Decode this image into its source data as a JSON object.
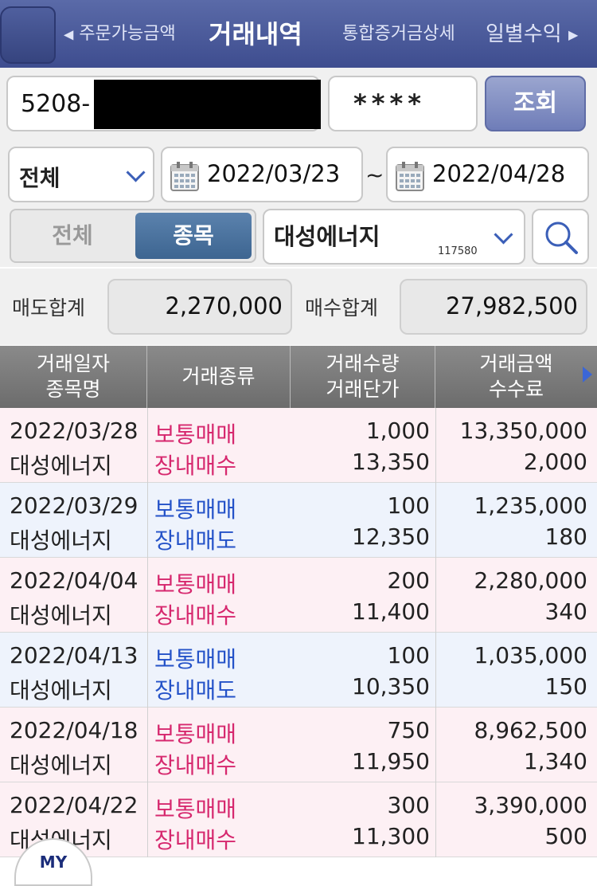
{
  "header": {
    "prev_tab": "주문가능금액",
    "title": "거래내역",
    "next_tab1": "통합증거금상세",
    "next_tab2": "일별수익"
  },
  "account": {
    "number_prefix": "5208-",
    "password": "****",
    "query_label": "조회"
  },
  "filters": {
    "type_select": "전체",
    "start_date": "2022/03/23",
    "end_date": "2022/04/28",
    "separator": "~",
    "segment": [
      "전체",
      "종목"
    ],
    "stock_name": "대성에너지",
    "stock_code": "117580"
  },
  "summary": {
    "sell_label": "매도합계",
    "sell_total": "2,270,000",
    "buy_label": "매수합계",
    "buy_total": "27,982,500"
  },
  "table": {
    "headers": [
      {
        "line1": "거래일자",
        "line2": "종목명"
      },
      {
        "line1": "거래종류",
        "line2": ""
      },
      {
        "line1": "거래수량",
        "line2": "거래단가"
      },
      {
        "line1": "거래금액",
        "line2": "수수료"
      }
    ],
    "rows": [
      {
        "date": "2022/03/28",
        "name": "대성에너지",
        "kind": "보통매매",
        "trade": "장내매수",
        "qty": "1,000",
        "price": "13,350",
        "amount": "13,350,000",
        "fee": "2,000",
        "side": "buy"
      },
      {
        "date": "2022/03/29",
        "name": "대성에너지",
        "kind": "보통매매",
        "trade": "장내매도",
        "qty": "100",
        "price": "12,350",
        "amount": "1,235,000",
        "fee": "180",
        "side": "sell"
      },
      {
        "date": "2022/04/04",
        "name": "대성에너지",
        "kind": "보통매매",
        "trade": "장내매수",
        "qty": "200",
        "price": "11,400",
        "amount": "2,280,000",
        "fee": "340",
        "side": "buy"
      },
      {
        "date": "2022/04/13",
        "name": "대성에너지",
        "kind": "보통매매",
        "trade": "장내매도",
        "qty": "100",
        "price": "10,350",
        "amount": "1,035,000",
        "fee": "150",
        "side": "sell"
      },
      {
        "date": "2022/04/18",
        "name": "대성에너지",
        "kind": "보통매매",
        "trade": "장내매수",
        "qty": "750",
        "price": "11,950",
        "amount": "8,962,500",
        "fee": "1,340",
        "side": "buy"
      },
      {
        "date": "2022/04/22",
        "name": "대성에너지",
        "kind": "보통매매",
        "trade": "장내매수",
        "qty": "300",
        "price": "11,300",
        "amount": "3,390,000",
        "fee": "500",
        "side": "buy"
      }
    ]
  },
  "floating": {
    "my_label": "MY"
  },
  "colors": {
    "buy": "#d6286e",
    "sell": "#2452c8",
    "header_bg": "#4a5a9c"
  }
}
